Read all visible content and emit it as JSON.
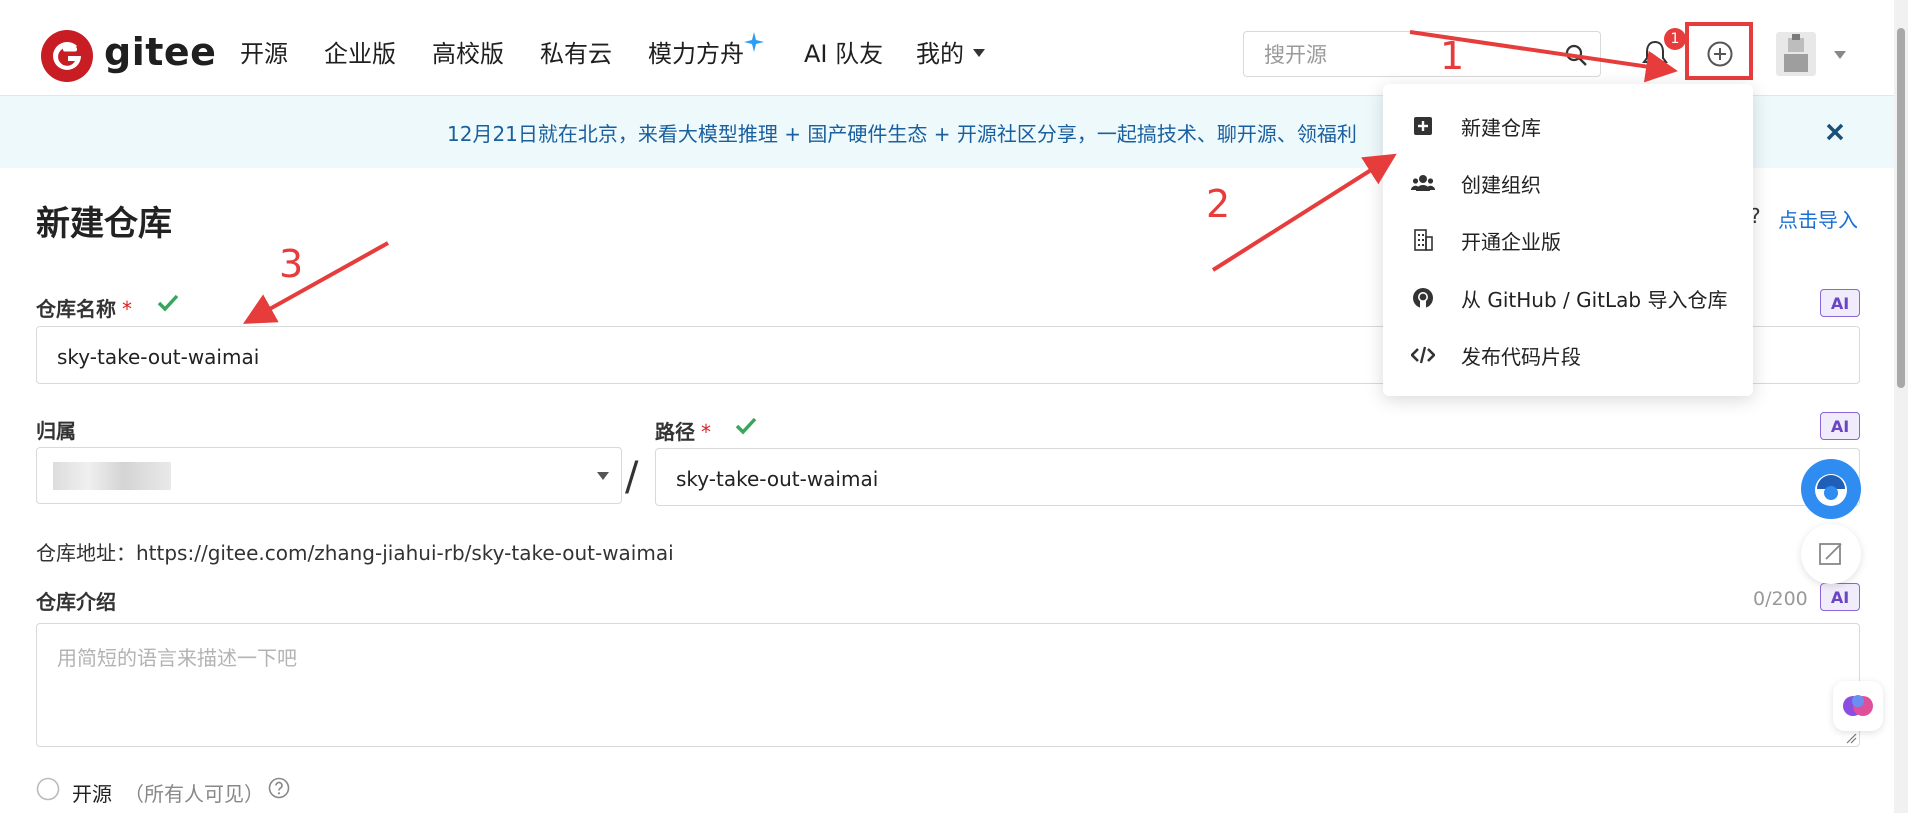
{
  "nav": {
    "logo_text": "gitee",
    "items": [
      "开源",
      "企业版",
      "高校版",
      "私有云",
      "模力方舟",
      "AI 队友",
      "我的"
    ],
    "search_placeholder": "搜开源",
    "notification_count": "1"
  },
  "banner": {
    "text": "12月21日就在北京，来看大模型推理 + 国产硬件生态 + 开源社区分享，一起搞技术、聊开源、领福利"
  },
  "dropdown": {
    "items": [
      "新建仓库",
      "创建组织",
      "开通企业版",
      "从 GitHub / GitLab 导入仓库",
      "发布代码片段"
    ]
  },
  "form": {
    "title": "新建仓库",
    "import_question": "?",
    "import_link": "点击导入",
    "repo_name_label": "仓库名称",
    "required_mark": "*",
    "repo_name_value": "sky-take-out-waimai",
    "owner_label": "归属",
    "path_label": "路径",
    "path_separator": "/",
    "path_value": "sky-take-out-waimai",
    "repo_url_label": "仓库地址：",
    "repo_url": "https://gitee.com/zhang-jiahui-rb/sky-take-out-waimai",
    "desc_label": "仓库介绍",
    "desc_placeholder": "用简短的语言来描述一下吧",
    "desc_count": "0/200",
    "ai_badge": "AI",
    "visibility_open_label": "开源",
    "visibility_open_hint": "（所有人可见）"
  },
  "annotations": [
    "1",
    "2",
    "3"
  ],
  "colors": {
    "brand_red": "#c71d23",
    "annotation_red": "#e63c3c",
    "link_blue": "#1a6fd3",
    "check_green": "#3aa55d",
    "ai_purple": "#6a46c4",
    "banner_bg": "#eef9fb"
  }
}
